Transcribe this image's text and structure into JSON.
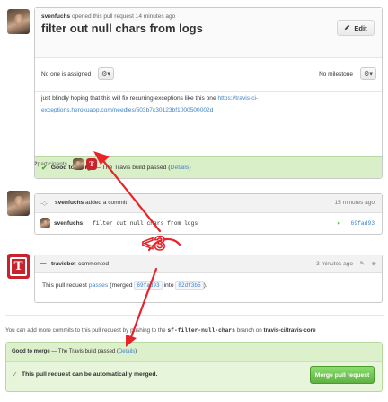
{
  "pr": {
    "author": "svenfuchs",
    "meta_rest": " opened this pull request 14 minutes ago",
    "title": "filter out null chars from logs",
    "edit_label": "Edit",
    "assignee": "No one is assigned",
    "milestone": "No milestone",
    "body_text": "just blindly hoping that this will fix recurring exceptions like this one ",
    "body_link": "https://travis-ci-exceptions.herokuapp.com/needles/503b7c30123bf1000500002d",
    "status_strong": "Good to merge",
    "status_rest": " — The Travis build passed (",
    "status_link": "Details",
    "status_close": ")"
  },
  "participants": {
    "count": "2",
    "label": " participants"
  },
  "commit": {
    "author": "svenfuchs",
    "action": " added a commit",
    "time": "15 minutes ago",
    "row_author": "svenfuchs",
    "message": "filter out null chars from logs",
    "sha": "69fad93"
  },
  "comment": {
    "author": "travisbot",
    "action": " commented",
    "time": "3 minutes ago",
    "text_pre": "This pull request ",
    "text_link": "passes",
    "text_mid": " (merged ",
    "sha1": "69fad93",
    "text_into": " into ",
    "sha2": "82df3b5",
    "text_end": ")."
  },
  "annotation": {
    "heart": "<3"
  },
  "hint": {
    "pre": "You can add more commits to this pull request by pushing to the ",
    "branch": "sf-filter-null-chars",
    "mid": " branch on ",
    "repo": "travis-ci/travis-core"
  },
  "merge": {
    "status_strong": "Good to merge",
    "status_rest": " — The Travis build passed (",
    "status_link": "Details",
    "status_close": ")",
    "auto_text": "This pull request can be automatically merged.",
    "button_label": "Merge pull request"
  },
  "colors": {
    "link": "#4183c4",
    "success_bg": "#d8efc8",
    "merge_button": "#60b044",
    "annotation_red": "#e8242a"
  }
}
